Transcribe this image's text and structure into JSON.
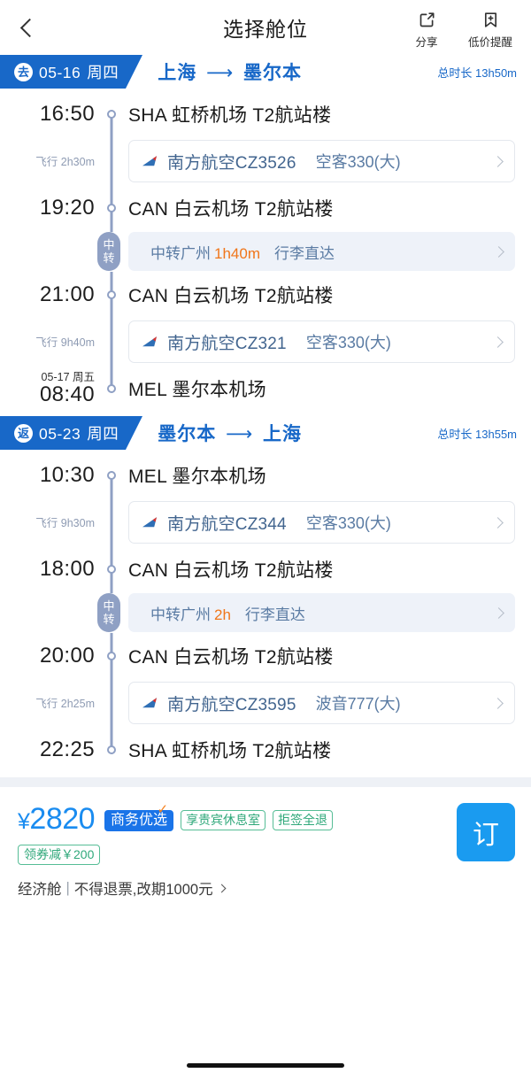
{
  "header": {
    "back_icon": "chevron-left-icon",
    "title": "选择舱位",
    "actions": [
      {
        "icon": "share-icon",
        "label": "分享"
      },
      {
        "icon": "bookmark-plus-icon",
        "label": "低价提醒"
      }
    ]
  },
  "colors": {
    "banner_blue": "#1868c8",
    "route_blue": "#1868c8",
    "rail_gray_blue": "#8fa0c4",
    "transfer_bg": "#eef2f9",
    "transfer_orange": "#f0761a",
    "price_blue": "#1a8cf0",
    "order_button_blue": "#1a9bf0",
    "badge_blue": "#1a74e8",
    "badge_green": "#2fa87a",
    "check_orange": "#f58220"
  },
  "trips": [
    {
      "direction_glyph": "去",
      "date": "05-16",
      "weekday": "周四",
      "from": "上海",
      "to": "墨尔本",
      "arrow": "✈",
      "total_label": "总时长",
      "total_duration": "13h50m",
      "steps": [
        {
          "kind": "stop",
          "time": "16:50",
          "date": "",
          "name": "SHA 虹桥机场 T2航站楼"
        },
        {
          "kind": "flight",
          "dur_prefix": "飞行",
          "duration": "2h30m",
          "airline": "南方航空CZ3526",
          "aircraft": "空客330(大)"
        },
        {
          "kind": "stop",
          "time": "19:20",
          "date": "",
          "name": "CAN 白云机场 T2航站楼"
        },
        {
          "kind": "transfer",
          "tab": "中转",
          "text": "中转广州",
          "duration": "1h40m",
          "extra": "行李直达"
        },
        {
          "kind": "stop",
          "time": "21:00",
          "date": "",
          "name": "CAN 白云机场 T2航站楼"
        },
        {
          "kind": "flight",
          "dur_prefix": "飞行",
          "duration": "9h40m",
          "airline": "南方航空CZ321",
          "aircraft": "空客330(大)"
        },
        {
          "kind": "stop",
          "time": "08:40",
          "date": "05-17 周五",
          "name": "MEL 墨尔本机场"
        }
      ]
    },
    {
      "direction_glyph": "返",
      "date": "05-23",
      "weekday": "周四",
      "from": "墨尔本",
      "to": "上海",
      "arrow": "✈",
      "total_label": "总时长",
      "total_duration": "13h55m",
      "steps": [
        {
          "kind": "stop",
          "time": "10:30",
          "date": "",
          "name": "MEL 墨尔本机场"
        },
        {
          "kind": "flight",
          "dur_prefix": "飞行",
          "duration": "9h30m",
          "airline": "南方航空CZ344",
          "aircraft": "空客330(大)"
        },
        {
          "kind": "stop",
          "time": "18:00",
          "date": "",
          "name": "CAN 白云机场 T2航站楼"
        },
        {
          "kind": "transfer",
          "tab": "中转",
          "text": "中转广州",
          "duration": "2h",
          "extra": "行李直达"
        },
        {
          "kind": "stop",
          "time": "20:00",
          "date": "",
          "name": "CAN 白云机场 T2航站楼"
        },
        {
          "kind": "flight",
          "dur_prefix": "飞行",
          "duration": "2h25m",
          "airline": "南方航空CZ3595",
          "aircraft": "波音777(大)"
        },
        {
          "kind": "stop",
          "time": "22:25",
          "date": "",
          "name": "SHA 虹桥机场 T2航站楼"
        }
      ]
    }
  ],
  "price_bar": {
    "currency": "¥",
    "amount": "2820",
    "primary_badge": "商务优选",
    "tag_badges": [
      "享贵宾休息室",
      "拒签全退"
    ],
    "coupon_badge": "领券减￥200",
    "order_button": "订",
    "cabin": "经济舱",
    "separator": "|",
    "fare_rule": "不得退票,改期1000元"
  }
}
